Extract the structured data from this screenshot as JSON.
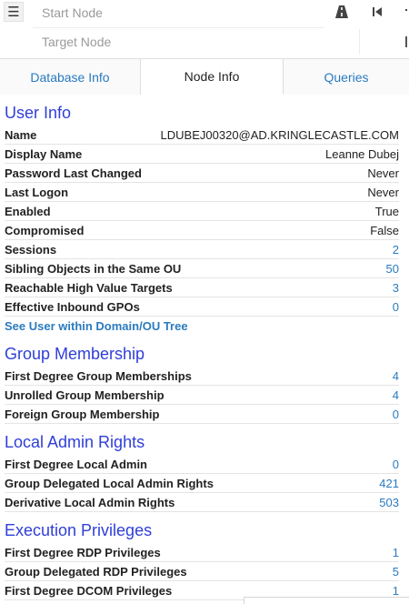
{
  "search": {
    "start_placeholder": "Start Node",
    "target_placeholder": "Target Node",
    "menu_icon": "menu-icon",
    "path_icon": "road-icon",
    "back_icon": "step-back-icon"
  },
  "tabs": [
    {
      "label": "Database Info"
    },
    {
      "label": "Node Info"
    },
    {
      "label": "Queries"
    }
  ],
  "user_info": {
    "title": "User Info",
    "rows": [
      {
        "key": "Name",
        "value": "LDUBEJ00320@AD.KRINGLECASTLE.COM"
      },
      {
        "key": "Display Name",
        "value": "Leanne Dubej"
      },
      {
        "key": "Password Last Changed",
        "value": "Never"
      },
      {
        "key": "Last Logon",
        "value": "Never"
      },
      {
        "key": "Enabled",
        "value": "True"
      },
      {
        "key": "Compromised",
        "value": "False"
      },
      {
        "key": "Sessions",
        "value": "2"
      },
      {
        "key": "Sibling Objects in the Same OU",
        "value": "50"
      },
      {
        "key": "Reachable High Value Targets",
        "value": "3"
      },
      {
        "key": "Effective Inbound GPOs",
        "value": "0"
      }
    ],
    "link": "See User within Domain/OU Tree"
  },
  "group_membership": {
    "title": "Group Membership",
    "rows": [
      {
        "key": "First Degree Group Memberships",
        "value": "4"
      },
      {
        "key": "Unrolled Group Membership",
        "value": "4"
      },
      {
        "key": "Foreign Group Membership",
        "value": "0"
      }
    ]
  },
  "local_admin": {
    "title": "Local Admin Rights",
    "rows": [
      {
        "key": "First Degree Local Admin",
        "value": "0"
      },
      {
        "key": "Group Delegated Local Admin Rights",
        "value": "421"
      },
      {
        "key": "Derivative Local Admin Rights",
        "value": "503"
      }
    ]
  },
  "execution": {
    "title": "Execution Privileges",
    "rows": [
      {
        "key": "First Degree RDP Privileges",
        "value": "1"
      },
      {
        "key": "Group Delegated RDP Privileges",
        "value": "5"
      },
      {
        "key": "First Degree DCOM Privileges",
        "value": "1"
      }
    ]
  },
  "colors": {
    "section_title": "#2f3fd8",
    "link": "#2a7bbf"
  }
}
